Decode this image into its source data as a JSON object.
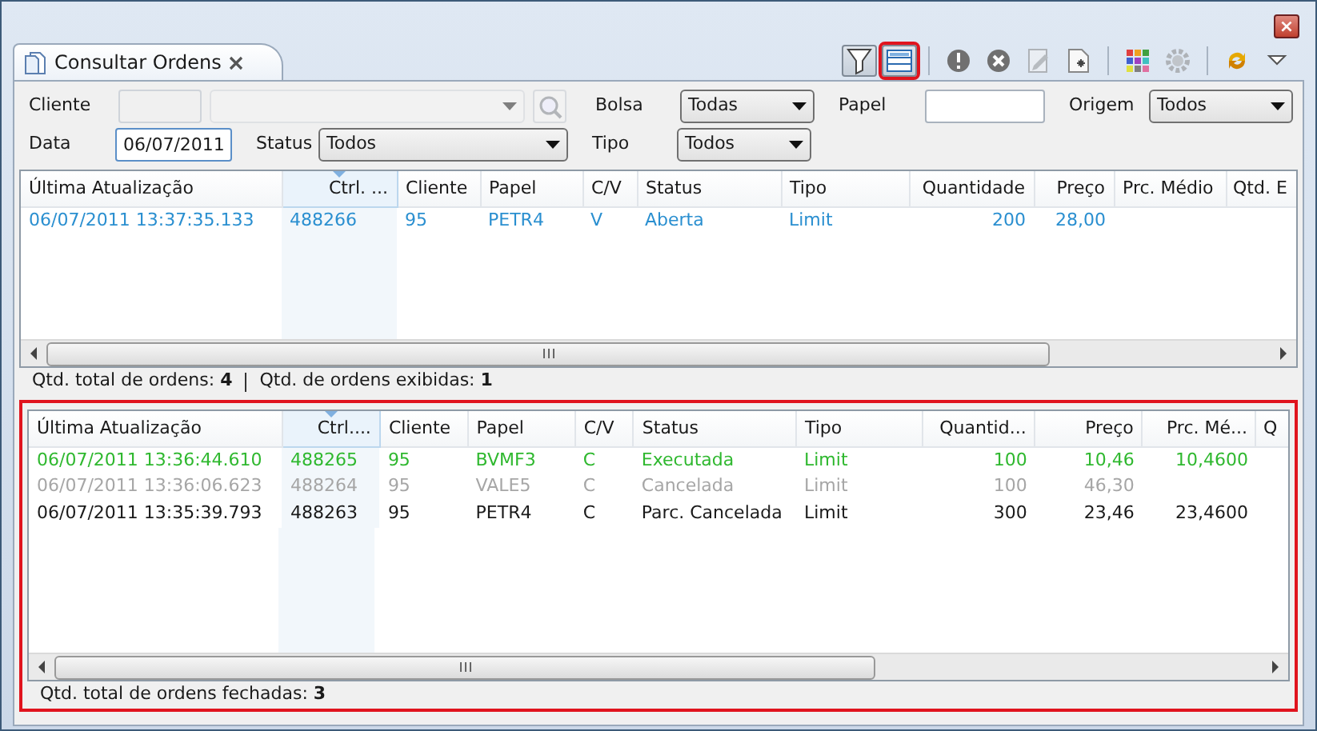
{
  "window": {
    "close_label": "×"
  },
  "tab": {
    "title": "Consultar Ordens",
    "selected": true
  },
  "toolbar": [
    {
      "kind": "filter",
      "pressed": true,
      "highlighted": false,
      "disabled": false
    },
    {
      "kind": "layout",
      "pressed": true,
      "highlighted": true,
      "disabled": false
    },
    {
      "kind": "separator"
    },
    {
      "kind": "alert",
      "pressed": false,
      "highlighted": false,
      "disabled": false
    },
    {
      "kind": "cancel",
      "pressed": false,
      "highlighted": false,
      "disabled": false
    },
    {
      "kind": "edit",
      "pressed": false,
      "highlighted": false,
      "disabled": true
    },
    {
      "kind": "new",
      "pressed": false,
      "highlighted": false,
      "disabled": false
    },
    {
      "kind": "separator"
    },
    {
      "kind": "colors",
      "pressed": false,
      "highlighted": false,
      "disabled": false
    },
    {
      "kind": "settings",
      "pressed": false,
      "highlighted": false,
      "disabled": true
    },
    {
      "kind": "separator"
    },
    {
      "kind": "refresh",
      "pressed": false,
      "highlighted": false,
      "disabled": false
    },
    {
      "kind": "menu",
      "pressed": false,
      "highlighted": false,
      "disabled": false
    }
  ],
  "filters": {
    "cliente": {
      "label": "Cliente",
      "disabled": true
    },
    "bolsa": {
      "label": "Bolsa",
      "value": "Todas"
    },
    "papel": {
      "label": "Papel"
    },
    "origem": {
      "label": "Origem",
      "value": "Todos"
    },
    "data": {
      "label": "Data",
      "value": "06/07/2011"
    },
    "status": {
      "label": "Status",
      "value": "Todos"
    },
    "tipo": {
      "label": "Tipo",
      "value": "Todos"
    }
  },
  "open_orders": {
    "columns": [
      {
        "label": "Última Atualização",
        "sorted": false
      },
      {
        "label": "Ctrl. ...",
        "sorted": true
      },
      {
        "label": "Cliente",
        "sorted": false
      },
      {
        "label": "Papel",
        "sorted": false
      },
      {
        "label": "C/V",
        "sorted": false
      },
      {
        "label": "Status",
        "sorted": false
      },
      {
        "label": "Tipo",
        "sorted": false
      },
      {
        "label": "Quantidade",
        "sorted": false
      },
      {
        "label": "Preço",
        "sorted": false
      },
      {
        "label": "Prc. Médio",
        "sorted": false
      },
      {
        "label": "Qtd. E",
        "sorted": false
      }
    ],
    "rows": [
      {
        "color": "#2a8fd0",
        "cells": [
          "06/07/2011 13:37:35.133",
          "488266",
          "95",
          "PETR4",
          "V",
          "Aberta",
          "Limit",
          "200",
          "28,00",
          null,
          null
        ]
      }
    ],
    "status": [
      {
        "label": "Qtd. total de ordens:",
        "value": "4"
      },
      {
        "label": "Qtd. de ordens exibidas:",
        "value": "1"
      }
    ]
  },
  "closed_orders": {
    "highlighted": true,
    "columns": [
      {
        "label": "Última Atualização",
        "sorted": false
      },
      {
        "label": "Ctrl....",
        "sorted": true
      },
      {
        "label": "Cliente",
        "sorted": false
      },
      {
        "label": "Papel",
        "sorted": false
      },
      {
        "label": "C/V",
        "sorted": false
      },
      {
        "label": "Status",
        "sorted": false
      },
      {
        "label": "Tipo",
        "sorted": false
      },
      {
        "label": "Quantid...",
        "sorted": false
      },
      {
        "label": "Preço",
        "sorted": false
      },
      {
        "label": "Prc. Mé...",
        "sorted": false
      },
      {
        "label": "Q",
        "sorted": false
      }
    ],
    "rows": [
      {
        "color": "#2fb82f",
        "cells": [
          "06/07/2011 13:36:44.610",
          "488265",
          "95",
          "BVMF3",
          "C",
          "Executada",
          "Limit",
          "100",
          "10,46",
          "10,4600",
          null
        ]
      },
      {
        "color": "#a6a6a6",
        "cells": [
          "06/07/2011 13:36:06.623",
          "488264",
          "95",
          "VALE5",
          "C",
          "Cancelada",
          "Limit",
          "100",
          "46,30",
          null,
          null
        ]
      },
      {
        "color": "#1a1a1a",
        "cells": [
          "06/07/2011 13:35:39.793",
          "488263",
          "95",
          "PETR4",
          "C",
          "Parc. Cancelada",
          "Limit",
          "300",
          "23,46",
          "23,4600",
          null
        ]
      }
    ],
    "status": [
      {
        "label": "Qtd. total de ordens fechadas:",
        "value": "3"
      }
    ]
  }
}
